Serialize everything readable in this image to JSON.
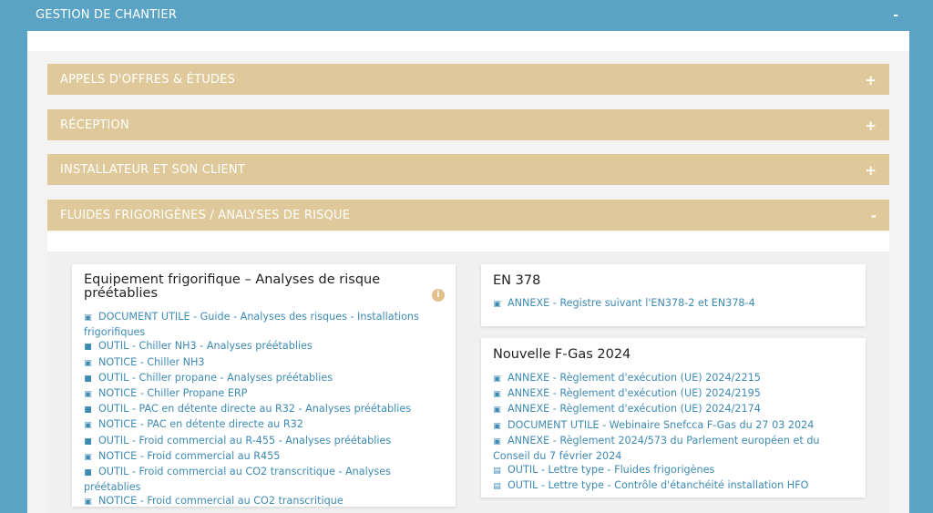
{
  "colors": {
    "background": "#5aa3c4",
    "accordion": "#dfc99a",
    "link": "#3d8ab3",
    "info": "#e0c08a"
  },
  "topbar": {
    "title": "GESTION DE CHANTIER",
    "toggle": "-"
  },
  "accordions": [
    {
      "label": "APPELS D'OFFRES & ÉTUDES",
      "sign": "+"
    },
    {
      "label": "RÉCEPTION",
      "sign": "+"
    },
    {
      "label": "INSTALLATEUR ET SON CLIENT",
      "sign": "+"
    },
    {
      "label": "FLUIDES FRIGORIGÈNES / ANALYSES DE RISQUE",
      "sign": "-"
    }
  ],
  "cards": {
    "left": {
      "title": "Equipement frigorifique – Analyses de risque préétablies",
      "info_icon": "i",
      "links": [
        {
          "icon": "pdf-icon",
          "glyph": "▣",
          "text": "DOCUMENT UTILE - Guide - Analyses des risques - Installations frigorifiques"
        },
        {
          "icon": "document-icon",
          "glyph": "■",
          "text": "OUTIL - Chiller NH3 - Analyses préétablies"
        },
        {
          "icon": "pdf-icon",
          "glyph": "▣",
          "text": "NOTICE - Chiller NH3"
        },
        {
          "icon": "document-icon",
          "glyph": "■",
          "text": "OUTIL - Chiller propane - Analyses préétablies"
        },
        {
          "icon": "pdf-icon",
          "glyph": "▣",
          "text": "NOTICE - Chiller Propane ERP"
        },
        {
          "icon": "document-icon",
          "glyph": "■",
          "text": "OUTIL - PAC en détente directe au R32 - Analyses préétablies"
        },
        {
          "icon": "pdf-icon",
          "glyph": "▣",
          "text": "NOTICE - PAC en détente directe au R32"
        },
        {
          "icon": "document-icon",
          "glyph": "■",
          "text": "OUTIL - Froid commercial au R-455 - Analyses préétablies"
        },
        {
          "icon": "pdf-icon",
          "glyph": "▣",
          "text": "NOTICE - Froid commercial au R455"
        },
        {
          "icon": "document-icon",
          "glyph": "■",
          "text": "OUTIL - Froid commercial au CO2 transcritique - Analyses préétablies"
        },
        {
          "icon": "pdf-icon",
          "glyph": "▣",
          "text": "NOTICE - Froid commercial au CO2 transcritique"
        }
      ]
    },
    "en378": {
      "title": "EN 378",
      "links": [
        {
          "icon": "pdf-icon",
          "glyph": "▣",
          "text": "ANNEXE - Registre suivant l'EN378-2 et EN378-4"
        }
      ]
    },
    "fgas": {
      "title": "Nouvelle F-Gas 2024",
      "links": [
        {
          "icon": "pdf-icon",
          "glyph": "▣",
          "text": "ANNEXE - Règlement d'exécution (UE) 2024/2215"
        },
        {
          "icon": "pdf-icon",
          "glyph": "▣",
          "text": "ANNEXE - Règlement d'exécution (UE) 2024/2195"
        },
        {
          "icon": "pdf-icon",
          "glyph": "▣",
          "text": "ANNEXE - Règlement d'exécution (UE) 2024/2174"
        },
        {
          "icon": "pdf-icon",
          "glyph": "▣",
          "text": "DOCUMENT UTILE - Webinaire Snefcca F-Gas du 27 03 2024"
        },
        {
          "icon": "pdf-icon",
          "glyph": "▣",
          "text": "ANNEXE - Règlement 2024/573 du Parlement européen et du Conseil du 7 février 2024"
        },
        {
          "icon": "word-icon",
          "glyph": "▤",
          "text": "OUTIL - Lettre type - Fluides frigorigènes"
        },
        {
          "icon": "word-icon",
          "glyph": "▤",
          "text": "OUTIL - Lettre type - Contrôle d'étanchéité installation HFO"
        }
      ]
    }
  }
}
